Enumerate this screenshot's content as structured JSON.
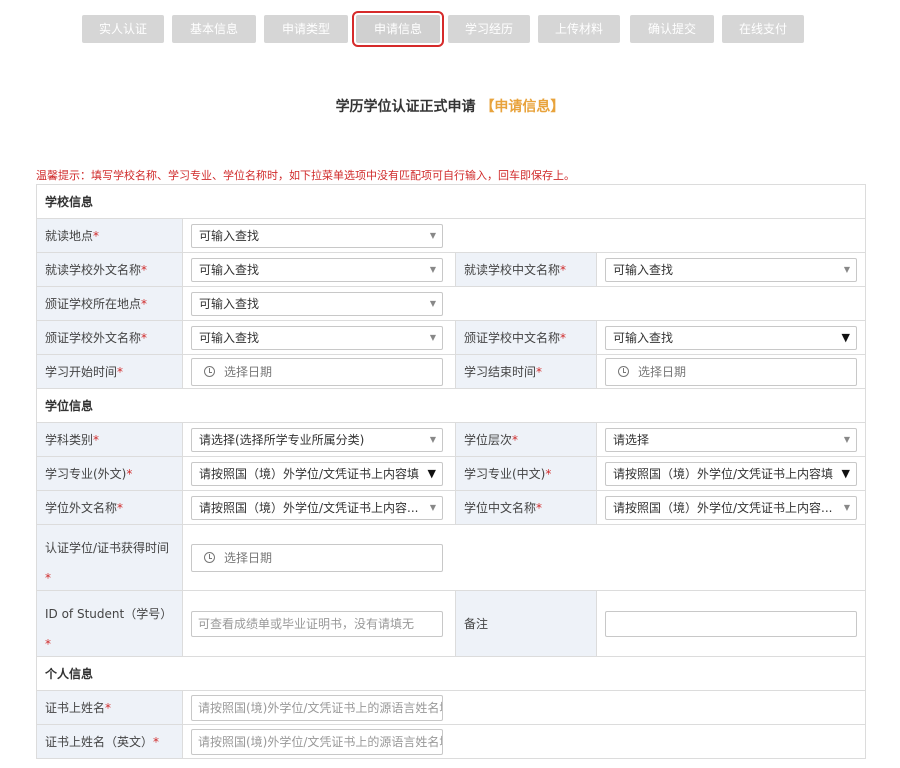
{
  "steps": [
    {
      "label": "实人认证"
    },
    {
      "label": "基本信息"
    },
    {
      "label": "申请类型"
    },
    {
      "label": "申请信息"
    },
    {
      "label": "学习经历"
    },
    {
      "label": "上传材料"
    },
    {
      "label": "确认提交"
    },
    {
      "label": "在线支付"
    }
  ],
  "page": {
    "title": "学历学位认证正式申请",
    "subtitle": "【申请信息】",
    "tip": "温馨提示：填写学校名称、学习专业、学位名称时，如下拉菜单选项中没有匹配项可自行输入，回车即保存上。"
  },
  "sections": {
    "school": "学校信息",
    "degree": "学位信息",
    "personal": "个人信息"
  },
  "fields": {
    "study_location": {
      "label": "就读地点",
      "value": "可输入查找"
    },
    "school_foreign_name": {
      "label": "就读学校外文名称",
      "value": "可输入查找"
    },
    "school_chinese_name": {
      "label": "就读学校中文名称 ",
      "value": "可输入查找"
    },
    "issuing_school_location": {
      "label": "颁证学校所在地点 ",
      "value": "可输入查找"
    },
    "issuing_school_foreign_name": {
      "label": "颁证学校外文名称 ",
      "value": "可输入查找"
    },
    "issuing_school_chinese_name": {
      "label": "颁证学校中文名称 ",
      "value": "可输入查找"
    },
    "study_start": {
      "label": "学习开始时间 ",
      "placeholder": "选择日期"
    },
    "study_end": {
      "label": "学习结束时间 ",
      "placeholder": "选择日期"
    },
    "discipline": {
      "label": "学科类别 ",
      "value": "请选择(选择所学专业所属分类)"
    },
    "degree_level": {
      "label": "学位层次 ",
      "value": "请选择"
    },
    "major_foreign": {
      "label": "学习专业(外文)",
      "value": "请按照国（境）外学位/文凭证书上内容填"
    },
    "major_chinese": {
      "label": "学习专业(中文) ",
      "value": "请按照国（境）外学位/文凭证书上内容填"
    },
    "degree_foreign_name": {
      "label": "学位外文名称 ",
      "value": "请按照国（境）外学位/文凭证书上内容..."
    },
    "degree_chinese_name": {
      "label": "学位中文名称",
      "value": "请按照国（境）外学位/文凭证书上内容..."
    },
    "certificate_time": {
      "label": "认证学位/证书获得时间",
      "placeholder": "选择日期"
    },
    "student_id": {
      "label": "ID of Student（学号）",
      "placeholder": "可查看成绩单或毕业证明书，没有请填无"
    },
    "remarks": {
      "label": "备注",
      "value": ""
    },
    "name_on_certificate": {
      "label": "证书上姓名",
      "placeholder": "请按照国(境)外学位/文凭证书上的源语言姓名填"
    },
    "name_on_certificate_en": {
      "label": "证书上姓名（英文）",
      "placeholder": "请按照国(境)外学位/文凭证书上的源语言姓名填"
    }
  },
  "required_mark": "*",
  "icons": {
    "dropdown": "triangle-down-icon",
    "date": "clock-icon"
  },
  "colors": {
    "accent": "#e8a33c",
    "required": "#d02b2b",
    "active_outline": "#d62a2a",
    "label_bg": "#eef2f8"
  }
}
